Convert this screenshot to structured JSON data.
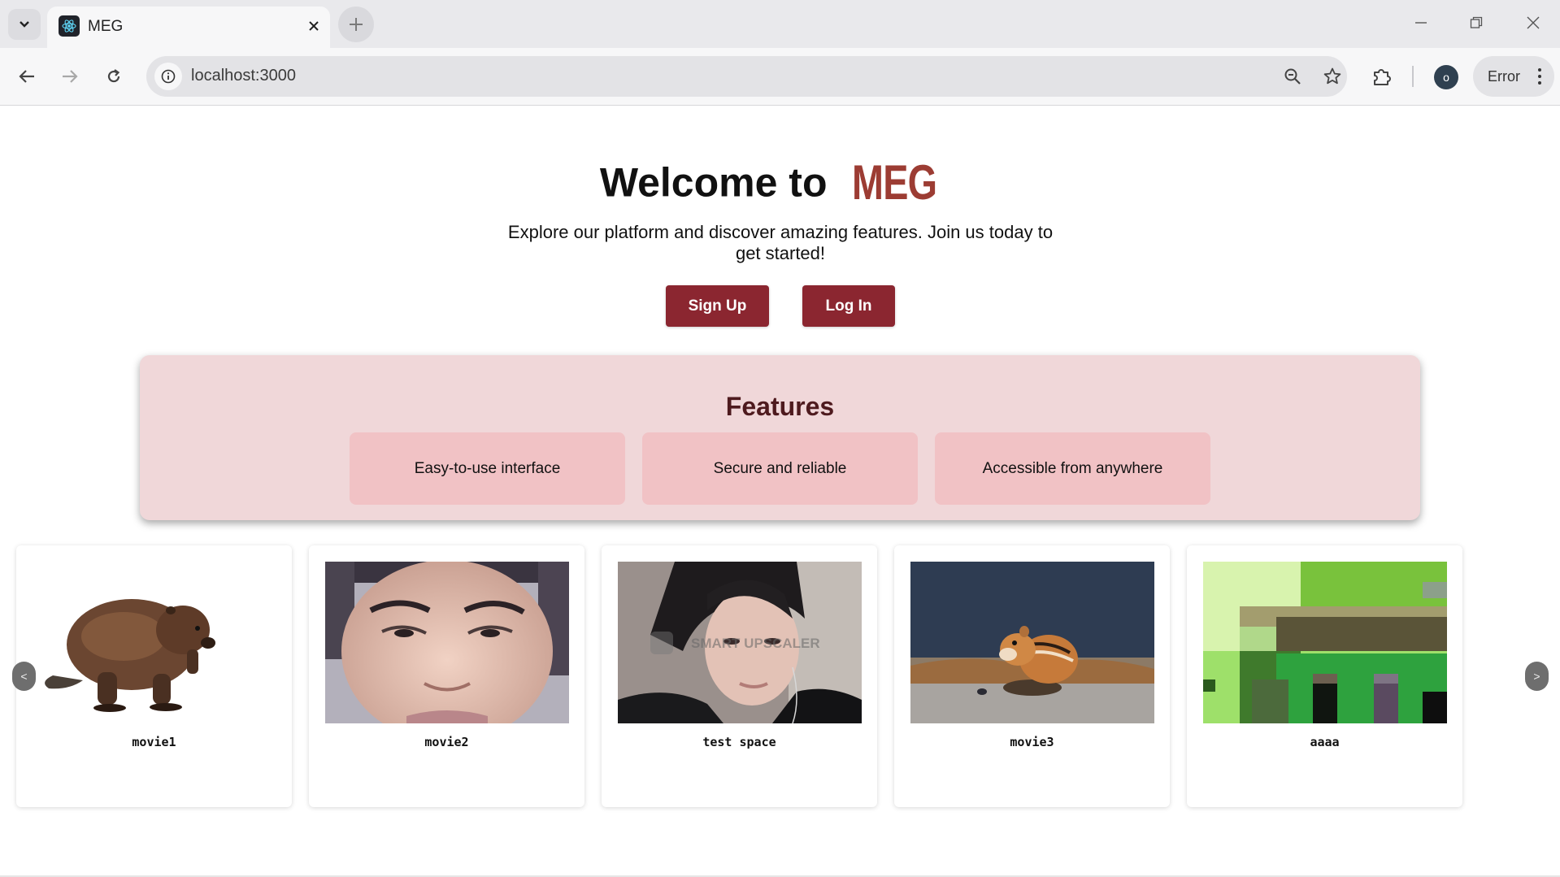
{
  "browser": {
    "tab_title": "MEG",
    "url": "localhost:3000",
    "profile_initial": "o",
    "error_label": "Error"
  },
  "hero": {
    "welcome": "Welcome to",
    "brand": "MEG",
    "subtitle": "Explore our platform and discover amazing features. Join us today to get started!",
    "signup_label": "Sign Up",
    "login_label": "Log In"
  },
  "features": {
    "title": "Features",
    "items": [
      "Easy-to-use interface",
      "Secure and reliable",
      "Accessible from anywhere"
    ]
  },
  "carousel": {
    "prev_label": "<",
    "next_label": ">",
    "movies": [
      {
        "title": "movie1",
        "image": "beaver"
      },
      {
        "title": "movie2",
        "image": "face-closeup"
      },
      {
        "title": "test space",
        "image": "portrait",
        "watermark": "SMART UPSCALER"
      },
      {
        "title": "movie3",
        "image": "chipmunk"
      },
      {
        "title": "aaaa",
        "image": "pixel-art"
      }
    ]
  },
  "colors": {
    "brand": "#9c3c33",
    "button": "#8b2630",
    "features_bg": "#f0d7d9",
    "feature_card_bg": "#f1c2c5",
    "features_title": "#4e1a1e"
  }
}
